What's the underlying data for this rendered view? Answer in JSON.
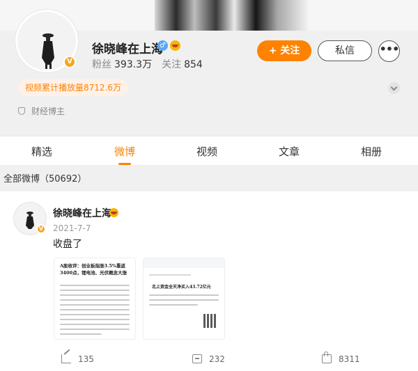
{
  "profile": {
    "name": "徐晓峰在上海",
    "gender_icon": "♂",
    "followers_label": "粉丝",
    "followers_value": "393.3万",
    "following_label": "关注",
    "following_value": "854",
    "follow_button": "+ 关注",
    "message_button": "私信",
    "more_button": "•••",
    "video_plays": "视频累计播放量8712.6万",
    "certification": "财经博主",
    "verified_badge": "V"
  },
  "tabs": [
    {
      "label": "精选",
      "active": false
    },
    {
      "label": "微博",
      "active": true
    },
    {
      "label": "视频",
      "active": false
    },
    {
      "label": "文章",
      "active": false
    },
    {
      "label": "相册",
      "active": false
    }
  ],
  "feed": {
    "section_title": "全部微博（50692）"
  },
  "post": {
    "author": "徐晓峰在上海",
    "date": "2021-7-7",
    "text": "收盘了",
    "image1_headline": "A股收评：创业板指涨3.5%重返3400点，锂电池、光伏概念大涨",
    "image2_headline": "北上资金全天净买入43.72亿元",
    "reposts": "135",
    "comments": "232",
    "likes": "8311"
  },
  "colors": {
    "accent": "#ff8200",
    "verified": "#f5a623",
    "gender": "#59a6f5"
  },
  "icons": [
    "gender-male-icon",
    "emoji-badge-icon",
    "verified-v-icon",
    "chevron-down-icon",
    "shield-icon",
    "share-icon",
    "comment-icon",
    "like-icon"
  ]
}
